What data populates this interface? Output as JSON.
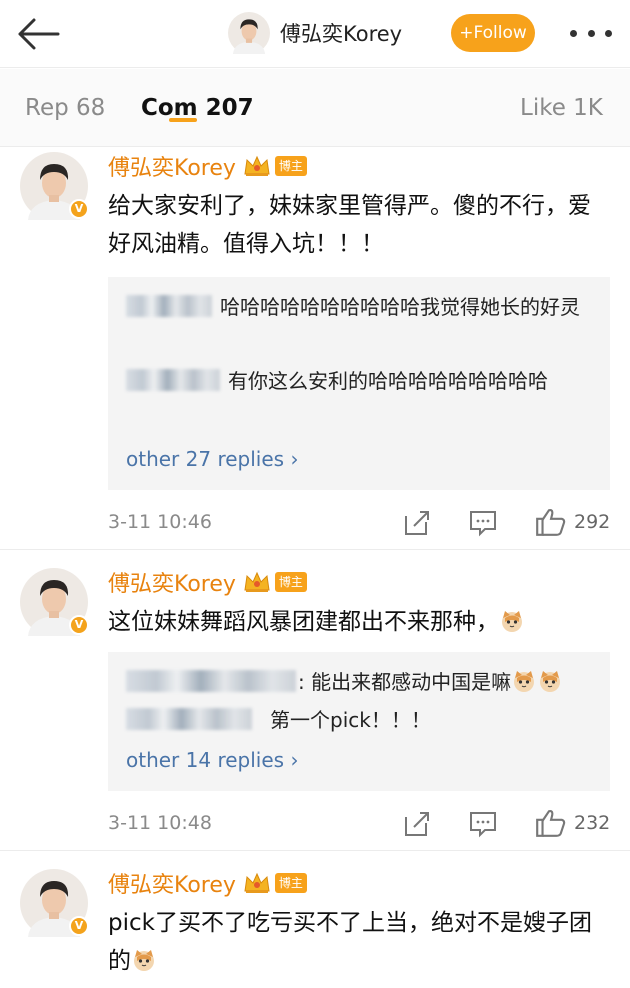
{
  "header": {
    "user_name": "傅弘奕Korey",
    "follow_label": "+Follow",
    "back_icon": "back-arrow-icon",
    "more_icon": "more-dots-icon",
    "accent_color": "#f7a21b"
  },
  "tabs": {
    "reposts": "Rep 68",
    "comments": "Com 207",
    "likes": "Like 1K"
  },
  "comments": [
    {
      "author": "傅弘奕Korey",
      "badge": "博主",
      "text": "给大家安利了，妹妹家里管得严。傻的不行，爱好风油精。值得入坑！！！",
      "replies": [
        {
          "text": "哈哈哈哈哈哈哈哈哈哈我觉得她长的好灵"
        },
        {
          "text": "有你这么安利的哈哈哈哈哈哈哈哈哈"
        }
      ],
      "more_replies": "other 27 replies",
      "timestamp": "3-11 10:46",
      "likes": "292"
    },
    {
      "author": "傅弘奕Korey",
      "badge": "博主",
      "text": "这位妹妹舞蹈风暴团建都出不来那种，",
      "replies": [
        {
          "text": ": 能出来都感动中国是嘛"
        },
        {
          "text": "第一个pick！！！"
        }
      ],
      "more_replies": "other 14 replies",
      "timestamp": "3-11 10:48",
      "likes": "232"
    },
    {
      "author": "傅弘奕Korey",
      "badge": "博主",
      "text": "pick了买不了吃亏买不了上当，绝对不是嫂子团的"
    }
  ]
}
